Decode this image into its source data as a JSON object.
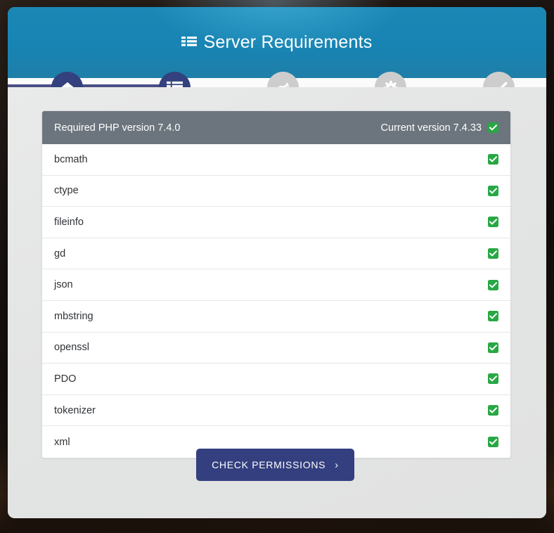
{
  "header": {
    "title": "Server Requirements",
    "title_icon": "list-icon"
  },
  "stepper": {
    "steps": [
      {
        "name": "home",
        "icon": "home-icon",
        "state": "active"
      },
      {
        "name": "requirements",
        "icon": "list-icon",
        "state": "active"
      },
      {
        "name": "permissions",
        "icon": "key-icon",
        "state": "inactive"
      },
      {
        "name": "settings",
        "icon": "gear-icon",
        "state": "inactive"
      },
      {
        "name": "finish",
        "icon": "check-icon",
        "state": "inactive"
      }
    ]
  },
  "requirements": {
    "header": {
      "required_label": "Required PHP version 7.4.0",
      "current_label": "Current version 7.4.33",
      "current_status": "ok"
    },
    "rows": [
      {
        "name": "bcmath",
        "status": "ok"
      },
      {
        "name": "ctype",
        "status": "ok"
      },
      {
        "name": "fileinfo",
        "status": "ok"
      },
      {
        "name": "gd",
        "status": "ok"
      },
      {
        "name": "json",
        "status": "ok"
      },
      {
        "name": "mbstring",
        "status": "ok"
      },
      {
        "name": "openssl",
        "status": "ok"
      },
      {
        "name": "PDO",
        "status": "ok"
      },
      {
        "name": "tokenizer",
        "status": "ok"
      },
      {
        "name": "xml",
        "status": "ok"
      }
    ]
  },
  "footer": {
    "button_label": "CHECK PERMISSIONS",
    "button_chevron": "›"
  },
  "colors": {
    "header_blue": "#1784b3",
    "step_active": "#33417e",
    "step_inactive": "#cdcdcd",
    "progress": "#4b4f86",
    "list_header_gray": "#6c757d",
    "status_green": "#27a844",
    "button_navy": "#343f7f",
    "body_gray": "#e4e5e5"
  }
}
